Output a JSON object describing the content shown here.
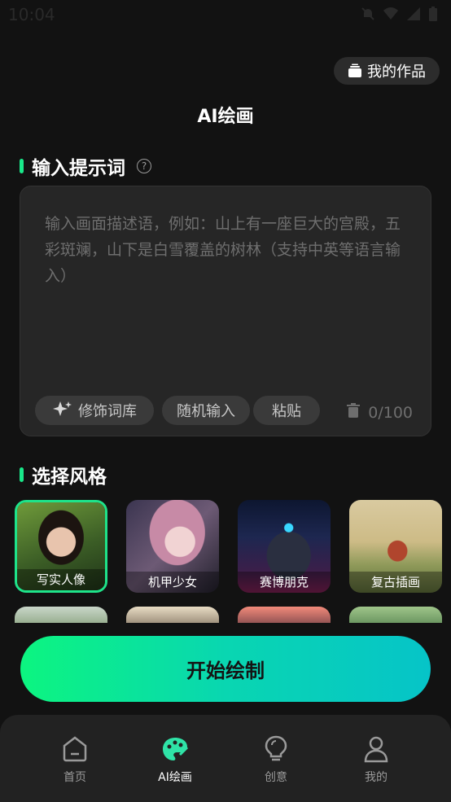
{
  "status_bar": {
    "time": "10:04"
  },
  "header": {
    "my_works_label": "我的作品",
    "title": "AI绘画"
  },
  "prompt_section": {
    "title": "输入提示词",
    "placeholder": "输入画面描述语，例如：山上有一座巨大的宫殿，五彩斑斓，山下是白雪覆盖的树林（支持中英等语言输入）",
    "value": "",
    "chips": {
      "embellish": "修饰词库",
      "random": "随机输入",
      "paste": "粘贴"
    },
    "counter": "0/100"
  },
  "style_section": {
    "title": "选择风格",
    "styles": [
      {
        "label": "写实人像",
        "selected": true
      },
      {
        "label": "机甲少女",
        "selected": false
      },
      {
        "label": "赛博朋克",
        "selected": false
      },
      {
        "label": "复古插画",
        "selected": false
      }
    ]
  },
  "start_button": {
    "label": "开始绘制"
  },
  "bottom_nav": {
    "items": [
      {
        "label": "首页",
        "icon": "home-icon",
        "active": false
      },
      {
        "label": "AI绘画",
        "icon": "palette-icon",
        "active": true
      },
      {
        "label": "创意",
        "icon": "lightbulb-icon",
        "active": false
      },
      {
        "label": "我的",
        "icon": "user-icon",
        "active": false
      }
    ]
  },
  "colors": {
    "accent": "#19e88a",
    "background": "#121212",
    "card": "#262626"
  }
}
